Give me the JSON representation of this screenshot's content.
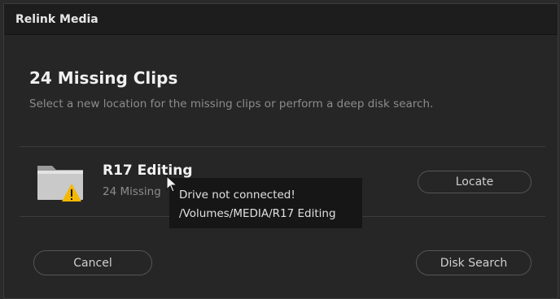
{
  "window": {
    "title": "Relink Media"
  },
  "main": {
    "heading": "24 Missing Clips",
    "subtitle": "Select a new location for the missing clips or perform a deep disk search."
  },
  "clip": {
    "name": "R17 Editing",
    "count_text": "24 Missing",
    "icon": "folder-warning-icon",
    "locate_label": "Locate"
  },
  "tooltip": {
    "line1": "Drive not connected!",
    "line2": "/Volumes/MEDIA/R17 Editing"
  },
  "buttons": {
    "cancel_label": "Cancel",
    "disk_search_label": "Disk Search"
  },
  "colors": {
    "background": "#262627",
    "titlebar": "#1d1d1e",
    "warning": "#f5b800",
    "tooltip_bg": "#161616"
  }
}
